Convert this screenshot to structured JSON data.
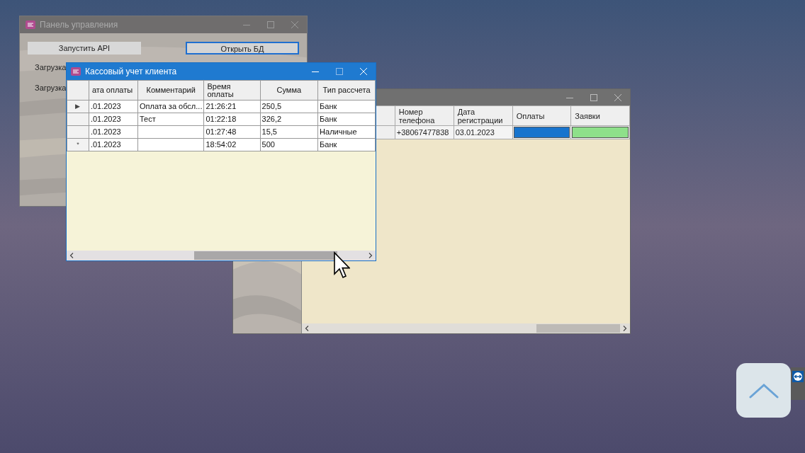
{
  "control_panel": {
    "title": "Панель управления",
    "buttons": [
      {
        "label": "Запустить API",
        "focused": false
      },
      {
        "label": "Открыть БД",
        "focused": true
      }
    ],
    "labels": [
      "Загрузка",
      "Загрузка"
    ]
  },
  "clients_window": {
    "columns": [
      "Номер телефона",
      "Дата регистрации",
      "Оплаты",
      "Заявки"
    ],
    "rows": [
      {
        "cells": [
          {
            "kind": "text",
            "text": "+38067477838"
          },
          {
            "kind": "text",
            "text": "03.01.2023"
          },
          {
            "kind": "swatch",
            "color": "#1874cd"
          },
          {
            "kind": "swatch",
            "color": "#8ee08a"
          }
        ]
      }
    ]
  },
  "cash_window": {
    "title": "Кассовый учет клиента",
    "columns": [
      "ата оплаты",
      "Комментарий",
      "Время оплаты",
      "Сумма",
      "Тип рассчета"
    ],
    "rows": [
      {
        "marker": "▶",
        "cells": [
          ".01.2023",
          "Оплата за обсл...",
          "21:26:21",
          "250,5",
          "Банк"
        ]
      },
      {
        "cells": [
          ".01.2023",
          "Тест",
          "01:22:18",
          "326,2",
          "Банк"
        ]
      },
      {
        "cells": [
          ".01.2023",
          "",
          "01:27:48",
          "15,5",
          "Наличные"
        ]
      },
      {
        "marker": "*",
        "cells": [
          ".01.2023",
          "",
          "18:54:02",
          "500",
          "Банк"
        ]
      }
    ]
  }
}
